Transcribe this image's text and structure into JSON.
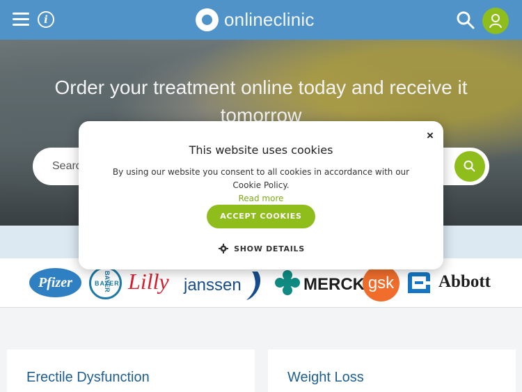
{
  "header": {
    "logo_text": "onlineclinic",
    "menu_icon": "menu-icon",
    "info_icon": "info-icon",
    "search_icon": "search-icon",
    "account_icon": "user-icon",
    "background_color": "#4f93c8"
  },
  "hero": {
    "title": "Order your treatment online today and receive it tomorrow",
    "search_placeholder": "Search"
  },
  "brand_logos": [
    "Pfizer",
    "BAYER",
    "Lilly",
    "janssen",
    "MERCK",
    "gsk",
    "Abbott"
  ],
  "categories": [
    {
      "title": "Erectile Dysfunction"
    },
    {
      "title": "Weight Loss"
    }
  ],
  "cookie_modal": {
    "title": "This website uses cookies",
    "message": "By using our website you consent to all cookies in accordance with our Cookie Policy.",
    "read_more": "Read more",
    "accept_label": "ACCEPT COOKIES",
    "details_label": "SHOW DETAILS",
    "close_label": "×",
    "accent_color": "#8fbd1c"
  }
}
